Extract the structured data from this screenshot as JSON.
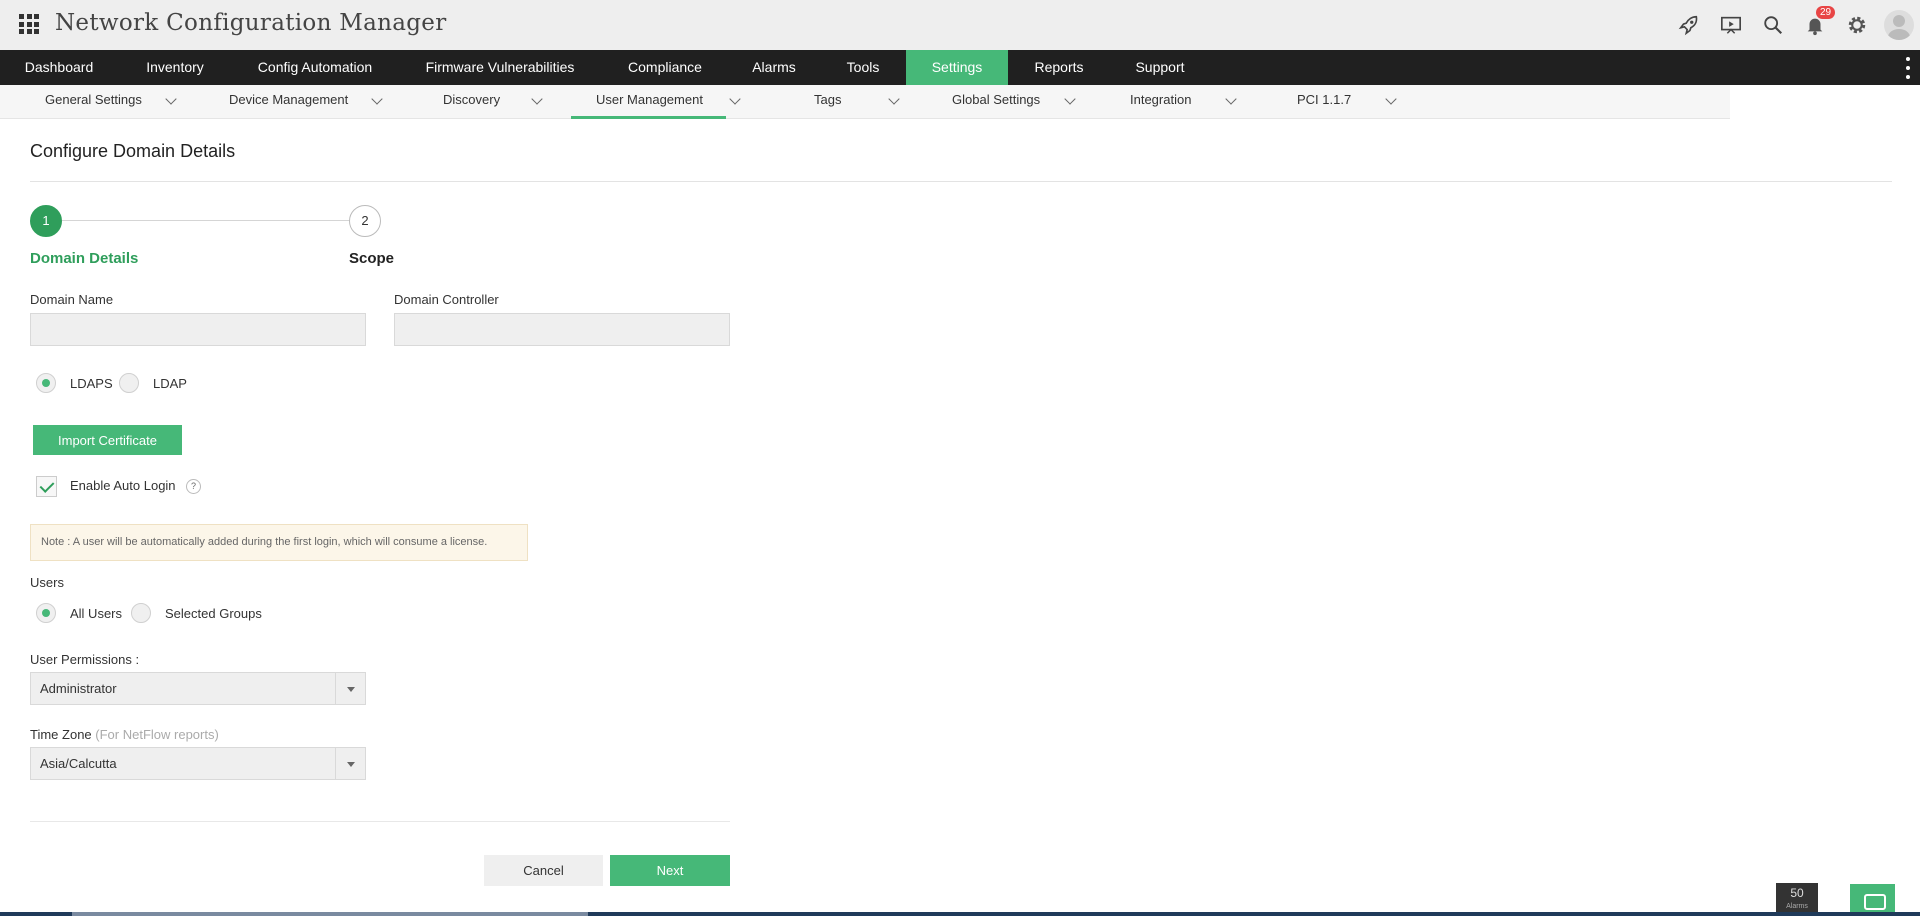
{
  "header": {
    "title": "Network Configuration Manager",
    "notification_count": "29",
    "icons": [
      "rocket-icon",
      "presentation-icon",
      "search-icon",
      "bell-icon",
      "gear-icon",
      "avatar"
    ]
  },
  "main_nav": {
    "items": [
      "Dashboard",
      "Inventory",
      "Config Automation",
      "Firmware Vulnerabilities",
      "Compliance",
      "Alarms",
      "Tools",
      "Settings",
      "Reports",
      "Support"
    ],
    "active": "Settings"
  },
  "sub_nav": {
    "items": [
      "General Settings",
      "Device Management",
      "Discovery",
      "User Management",
      "Tags",
      "Global Settings",
      "Integration",
      "PCI 1.1.7"
    ],
    "active": "User Management"
  },
  "page": {
    "title": "Configure Domain Details"
  },
  "wizard": {
    "steps": [
      {
        "number": "1",
        "label": "Domain Details",
        "active": true
      },
      {
        "number": "2",
        "label": "Scope",
        "active": false
      }
    ]
  },
  "form": {
    "domain_name_label": "Domain Name",
    "domain_name_value": "",
    "domain_controller_label": "Domain Controller",
    "domain_controller_value": "",
    "protocol_options": [
      "LDAPS",
      "LDAP"
    ],
    "protocol_selected": "LDAPS",
    "import_certificate_label": "Import Certificate",
    "auto_login_label": "Enable Auto Login",
    "auto_login_checked": true,
    "help_icon": "?",
    "note": "Note : A user will be automatically added during the first login, which will consume a license.",
    "users_label": "Users",
    "user_options": [
      "All Users",
      "Selected Groups"
    ],
    "users_selected": "All Users",
    "permissions_label": "User Permissions :",
    "permissions_value": "Administrator",
    "timezone_label": "Time Zone",
    "timezone_hint": "(For NetFlow reports)",
    "timezone_value": "Asia/Calcutta",
    "cancel_label": "Cancel",
    "next_label": "Next"
  },
  "footer": {
    "alarm_count": "50",
    "alarm_label": "Alarms"
  },
  "colors": {
    "accent": "#46b878",
    "accent_dark": "#2f9e5b",
    "nav_bg": "#202020"
  }
}
